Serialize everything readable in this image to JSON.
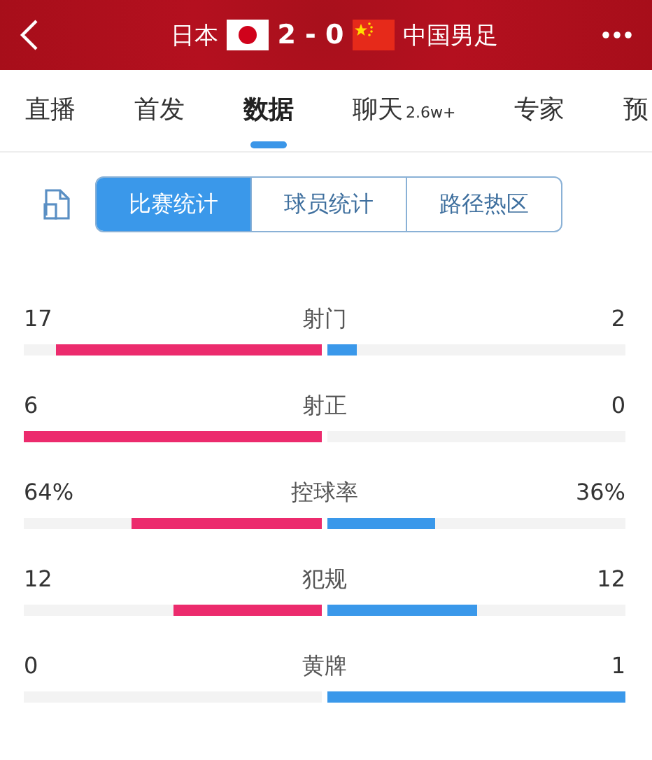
{
  "header": {
    "home": "日本",
    "score": "2 - 0",
    "away": "中国男足"
  },
  "tabs": [
    {
      "label": "直播",
      "selected": false
    },
    {
      "label": "首发",
      "selected": false
    },
    {
      "label": "数据",
      "selected": true
    },
    {
      "label": "聊天",
      "badge": "2.6w+",
      "selected": false
    },
    {
      "label": "专家",
      "selected": false
    },
    {
      "label": "预",
      "selected": false
    }
  ],
  "segments": [
    {
      "label": "比赛统计",
      "selected": true
    },
    {
      "label": "球员统计",
      "selected": false
    },
    {
      "label": "路径热区",
      "selected": false
    }
  ],
  "stats": [
    {
      "name": "射门",
      "home": "17",
      "away": "2",
      "home_bar": {
        "level": 0.89
      },
      "away_bar": {
        "level": 0.1
      }
    },
    {
      "name": "射正",
      "home": "6",
      "away": "0",
      "home_bar": {
        "level": 1
      },
      "away_bar": {
        "level": 0
      }
    },
    {
      "name": "控球率",
      "home": "64%",
      "away": "36%",
      "home_bar": {
        "level": 0.64
      },
      "away_bar": {
        "level": 0.36
      }
    },
    {
      "name": "犯规",
      "home": "12",
      "away": "12",
      "home_bar": {
        "level": 0.5
      },
      "away_bar": {
        "level": 0.5
      }
    },
    {
      "name": "黄牌",
      "home": "0",
      "away": "1",
      "home_bar": {
        "level": 0
      },
      "away_bar": {
        "level": 1
      }
    }
  ]
}
